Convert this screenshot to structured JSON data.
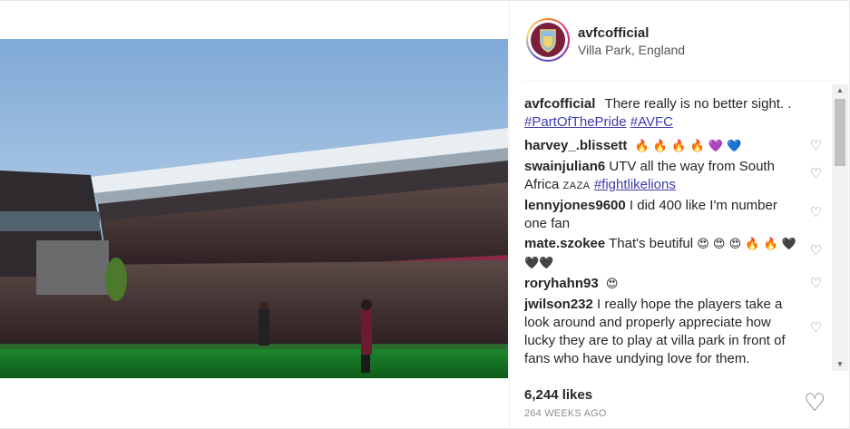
{
  "account": {
    "username": "avfcofficial",
    "location": "Villa Park, England",
    "avatar_text": "AVFC"
  },
  "comments": [
    {
      "user": "avfcofficial",
      "text": "There really is no better sight. .",
      "tags": [
        "#PartOfThePride",
        "#AVFC"
      ]
    },
    {
      "user": "harvey_.blissett",
      "text": "🔥 🔥 🔥 🔥 💜 💙"
    },
    {
      "user": "swainjulian6",
      "text": "UTV all the way from South Africa",
      "extra": "ZAZA",
      "tag": "#fightlikelions"
    },
    {
      "user": "lennyjones9600",
      "text": "I did 400 like I'm number one fan"
    },
    {
      "user": "mate.szokee",
      "text": "That's beutiful",
      "emoji": "😍 😍 😍 🔥 🔥 🖤🖤🖤"
    },
    {
      "user": "roryhahn93",
      "text": "😍"
    },
    {
      "user": "jwilson232",
      "text": "I really hope the players take a look around and properly appreciate how lucky they are to play at villa park in front of fans who have undying love for them."
    }
  ],
  "icons": {
    "comment_heart": "♡",
    "like_heart": "♡",
    "scroll_up": "▲",
    "scroll_down": "▼"
  },
  "footer": {
    "likes": "6,244 likes",
    "time": "264 WEEKS AGO"
  }
}
